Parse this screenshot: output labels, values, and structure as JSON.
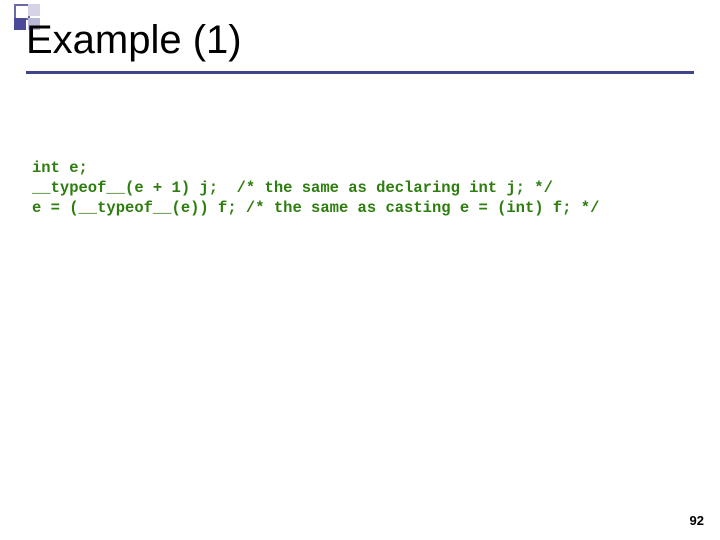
{
  "slide": {
    "title": "Example (1)",
    "page_number": "92"
  },
  "code": {
    "line1": "int e;",
    "line2": "__typeof__(e + 1) j;  /* the same as declaring int j; */",
    "line3": "e = (__typeof__(e)) f; /* the same as casting e = (int) f; */"
  }
}
